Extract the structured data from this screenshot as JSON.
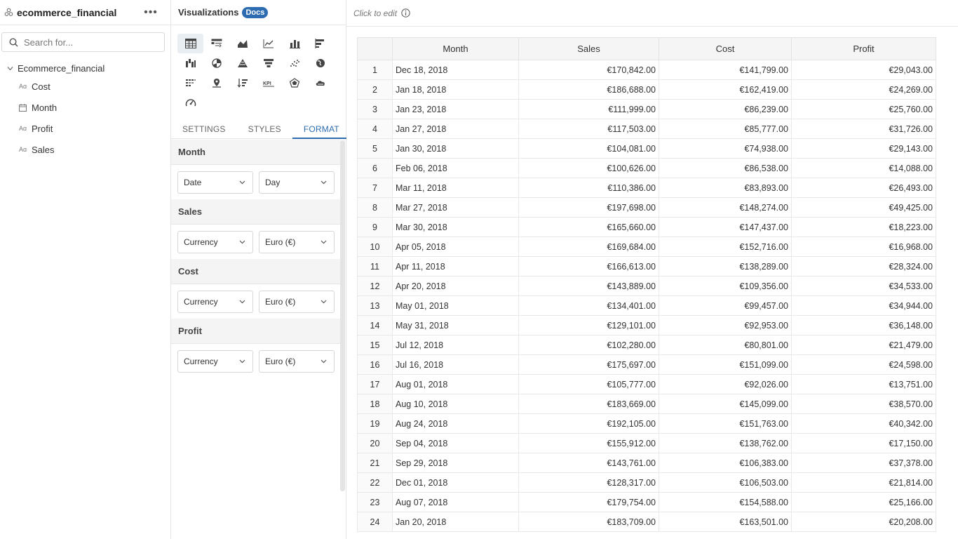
{
  "left": {
    "title": "ecommerce_financial",
    "search_placeholder": "Search for...",
    "tree_root": "Ecommerce_financial",
    "fields": [
      {
        "type": "text",
        "label": "Cost"
      },
      {
        "type": "date",
        "label": "Month"
      },
      {
        "type": "text",
        "label": "Profit"
      },
      {
        "type": "text",
        "label": "Sales"
      }
    ]
  },
  "mid": {
    "title": "Visualizations",
    "docs_label": "Docs",
    "viz_icons": [
      [
        "table-icon",
        "pivot-table-icon",
        "area-chart-icon",
        "line-chart-icon",
        "bar-chart-icon",
        "horizontal-bar-icon"
      ],
      [
        "waterfall-icon",
        "pie-chart-icon",
        "pyramid-icon",
        "funnel-icon",
        "scatter-icon",
        "map-icon"
      ],
      [
        "heatmap-icon",
        "geo-map-icon",
        "sort-icon",
        "kpi-icon",
        "radar-icon",
        "cloud-icon"
      ],
      [
        "gauge-icon"
      ]
    ],
    "tabs": [
      "SETTINGS",
      "STYLES",
      "FORMAT"
    ],
    "active_tab": "FORMAT",
    "format_sections": [
      {
        "name": "Month",
        "type": "Date",
        "subtype": "Day"
      },
      {
        "name": "Sales",
        "type": "Currency",
        "subtype": "Euro (€)"
      },
      {
        "name": "Cost",
        "type": "Currency",
        "subtype": "Euro (€)"
      },
      {
        "name": "Profit",
        "type": "Currency",
        "subtype": "Euro (€)"
      }
    ]
  },
  "right": {
    "click_to_edit": "Click to edit",
    "columns": [
      "",
      "Month",
      "Sales",
      "Cost",
      "Profit"
    ],
    "rows": [
      [
        "1",
        "Dec 18, 2018",
        "€170,842.00",
        "€141,799.00",
        "€29,043.00"
      ],
      [
        "2",
        "Jan 18, 2018",
        "€186,688.00",
        "€162,419.00",
        "€24,269.00"
      ],
      [
        "3",
        "Jan 23, 2018",
        "€111,999.00",
        "€86,239.00",
        "€25,760.00"
      ],
      [
        "4",
        "Jan 27, 2018",
        "€117,503.00",
        "€85,777.00",
        "€31,726.00"
      ],
      [
        "5",
        "Jan 30, 2018",
        "€104,081.00",
        "€74,938.00",
        "€29,143.00"
      ],
      [
        "6",
        "Feb 06, 2018",
        "€100,626.00",
        "€86,538.00",
        "€14,088.00"
      ],
      [
        "7",
        "Mar 11, 2018",
        "€110,386.00",
        "€83,893.00",
        "€26,493.00"
      ],
      [
        "8",
        "Mar 27, 2018",
        "€197,698.00",
        "€148,274.00",
        "€49,425.00"
      ],
      [
        "9",
        "Mar 30, 2018",
        "€165,660.00",
        "€147,437.00",
        "€18,223.00"
      ],
      [
        "10",
        "Apr 05, 2018",
        "€169,684.00",
        "€152,716.00",
        "€16,968.00"
      ],
      [
        "11",
        "Apr 11, 2018",
        "€166,613.00",
        "€138,289.00",
        "€28,324.00"
      ],
      [
        "12",
        "Apr 20, 2018",
        "€143,889.00",
        "€109,356.00",
        "€34,533.00"
      ],
      [
        "13",
        "May 01, 2018",
        "€134,401.00",
        "€99,457.00",
        "€34,944.00"
      ],
      [
        "14",
        "May 31, 2018",
        "€129,101.00",
        "€92,953.00",
        "€36,148.00"
      ],
      [
        "15",
        "Jul 12, 2018",
        "€102,280.00",
        "€80,801.00",
        "€21,479.00"
      ],
      [
        "16",
        "Jul 16, 2018",
        "€175,697.00",
        "€151,099.00",
        "€24,598.00"
      ],
      [
        "17",
        "Aug 01, 2018",
        "€105,777.00",
        "€92,026.00",
        "€13,751.00"
      ],
      [
        "18",
        "Aug 10, 2018",
        "€183,669.00",
        "€145,099.00",
        "€38,570.00"
      ],
      [
        "19",
        "Aug 24, 2018",
        "€192,105.00",
        "€151,763.00",
        "€40,342.00"
      ],
      [
        "20",
        "Sep 04, 2018",
        "€155,912.00",
        "€138,762.00",
        "€17,150.00"
      ],
      [
        "21",
        "Sep 29, 2018",
        "€143,761.00",
        "€106,383.00",
        "€37,378.00"
      ],
      [
        "22",
        "Dec 01, 2018",
        "€128,317.00",
        "€106,503.00",
        "€21,814.00"
      ],
      [
        "23",
        "Aug 07, 2018",
        "€179,754.00",
        "€154,588.00",
        "€25,166.00"
      ],
      [
        "24",
        "Jan 20, 2018",
        "€183,709.00",
        "€163,501.00",
        "€20,208.00"
      ]
    ]
  }
}
